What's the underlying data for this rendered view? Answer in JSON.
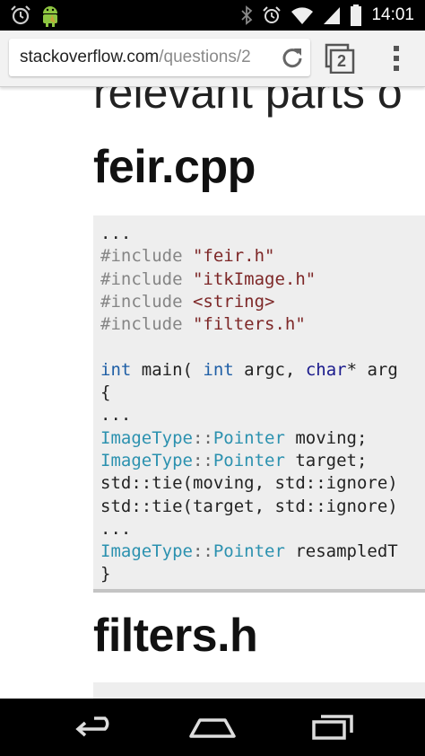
{
  "status": {
    "time": "14:01"
  },
  "browser": {
    "url_host": "stackoverflow.com",
    "url_path": "/questions/2",
    "tab_count": "2"
  },
  "content": {
    "partial_heading": "relevant parts o",
    "heading1": "feir.cpp",
    "heading2": "filters.h",
    "code": {
      "l1": "...",
      "l2_kw": "#include",
      "l2_str": "\"feir.h\"",
      "l3_kw": "#include",
      "l3_str": "\"itkImage.h\"",
      "l4_kw": "#include",
      "l4_str": "<string>",
      "l5_kw": "#include",
      "l5_str": "\"filters.h\"",
      "l7_int": "int",
      "l7_a": " main( ",
      "l7_int2": "int",
      "l7_b": " argc, ",
      "l7_char": "char",
      "l7_c": "* arg",
      "l8": "{",
      "l9": "...",
      "l10_t": "ImageType",
      "l10_op": "::",
      "l10_p": "Pointer",
      "l10_rest": " moving;",
      "l11_t": "ImageType",
      "l11_op": "::",
      "l11_p": "Pointer",
      "l11_rest": " target;",
      "l12": "std::tie(moving, std::ignore)",
      "l13": "std::tie(target, std::ignore)",
      "l14": "...",
      "l15_t": "ImageType",
      "l15_op": "::",
      "l15_p": "Pointer",
      "l15_rest": " resampledT",
      "l16": "}"
    }
  }
}
